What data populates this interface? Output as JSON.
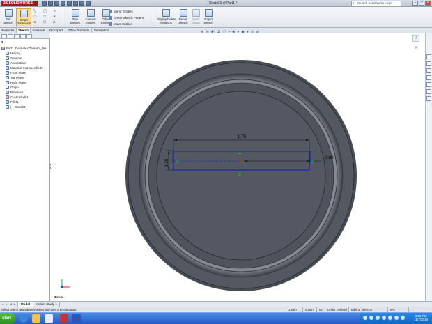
{
  "app": {
    "logo": "3S SOLIDWORKS",
    "document_title": "Sketch3 of Part1 *",
    "search_placeholder": "Search SolidWorks Help"
  },
  "ribbon": {
    "exit_sketch": "Exit Sketch",
    "smart_dimension": "Smart Dimension",
    "trim_entities": "Trim Entities",
    "convert_entities": "Convert Entities",
    "offset_entities": "Offset Entities",
    "mirror_entities": "Mirror Entities",
    "linear_sketch_pattern": "Linear Sketch Pattern",
    "move_entities": "Move Entities",
    "display_delete_relations": "Display/Delete Relations",
    "repair_sketch": "Repair Sketch",
    "quick_snaps": "Quick Snaps",
    "rapid_sketch": "Rapid Sketch"
  },
  "command_tabs": [
    "Features",
    "Sketch",
    "Evaluate",
    "DimXpert",
    "Office Products",
    "Simulation"
  ],
  "feature_tree": [
    {
      "label": "Part1 (Default<<Default>_Dis",
      "level": 0,
      "color": "#d2c06a"
    },
    {
      "label": "History",
      "level": 1,
      "color": "#d8e0ea"
    },
    {
      "label": "Sensors",
      "level": 1,
      "color": "#d8e0ea"
    },
    {
      "label": "Annotations",
      "level": 1,
      "color": "#f4d66c"
    },
    {
      "label": "Material <not specified>",
      "level": 1,
      "color": "#cfd3e4"
    },
    {
      "label": "Front Plane",
      "level": 1,
      "color": "#c6d8ea"
    },
    {
      "label": "Top Plane",
      "level": 1,
      "color": "#c6d8ea"
    },
    {
      "label": "Right Plane",
      "level": 1,
      "color": "#c6d8ea"
    },
    {
      "label": "Origin",
      "level": 1,
      "color": "#efefef"
    },
    {
      "label": "Revolve1",
      "level": 1,
      "color": "#d9c978"
    },
    {
      "label": "Cut-Extrude1",
      "level": 1,
      "color": "#d9c978"
    },
    {
      "label": "Fillet1",
      "level": 1,
      "color": "#d9c978"
    },
    {
      "label": "(-) Sketch3",
      "level": 1,
      "color": "#dbe7f5"
    }
  ],
  "sketch": {
    "dim_width": "1.75",
    "dim_height": "0.25",
    "dim_offset": "0.88",
    "view_label": "*Front"
  },
  "bottom_tabs": [
    "Model",
    "Motion Study 1"
  ],
  "status_bar": {
    "hint": "Select one or two edges/vertices and then a text location.",
    "x": "1.63in",
    "y": "0.10in",
    "z": "0in",
    "definition": "Under Defined",
    "mode": "Editing Sketch3",
    "units": "IPS"
  },
  "taskbar": {
    "start": "start",
    "time": "3:16 PM",
    "date": "11/7/2014"
  },
  "colors": {
    "part_fill": "#545863",
    "sketch_line": "#0a17c8",
    "relation": "#10c82a",
    "accent": "#9d1a1e"
  }
}
